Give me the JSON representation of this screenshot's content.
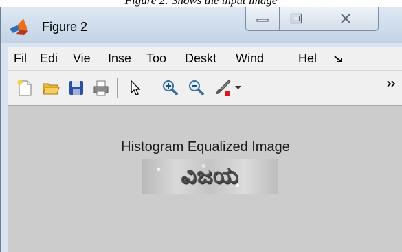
{
  "caption": "Figure 2: Shows the input image",
  "window": {
    "title": "Figure 2",
    "controls": {
      "minimize": "minimize-icon",
      "maximize": "maximize-icon",
      "close": "close-icon"
    }
  },
  "menubar": {
    "items": [
      "Fil",
      "Edi",
      "Vie",
      "Inse",
      "Too",
      "Deskt",
      "Wind",
      "Hel"
    ],
    "overflow_icon": "menu-overflow-arrow-icon"
  },
  "toolbar": {
    "buttons": [
      "new-figure-icon",
      "open-file-icon",
      "save-icon",
      "print-icon",
      "select-arrow-icon",
      "zoom-in-icon",
      "zoom-out-icon",
      "brush-icon",
      "dropdown-arrow-icon",
      "overflow-chevron-icon"
    ]
  },
  "figure": {
    "plot_title": "Histogram Equalized Image",
    "image_text": "ವಿಜಯ"
  },
  "colors": {
    "canvas_bg": "#cccccc",
    "titlebar_bg": "#cfdceb",
    "menubar_bg": "#f0f0f0",
    "close_x": "#5c6470"
  }
}
